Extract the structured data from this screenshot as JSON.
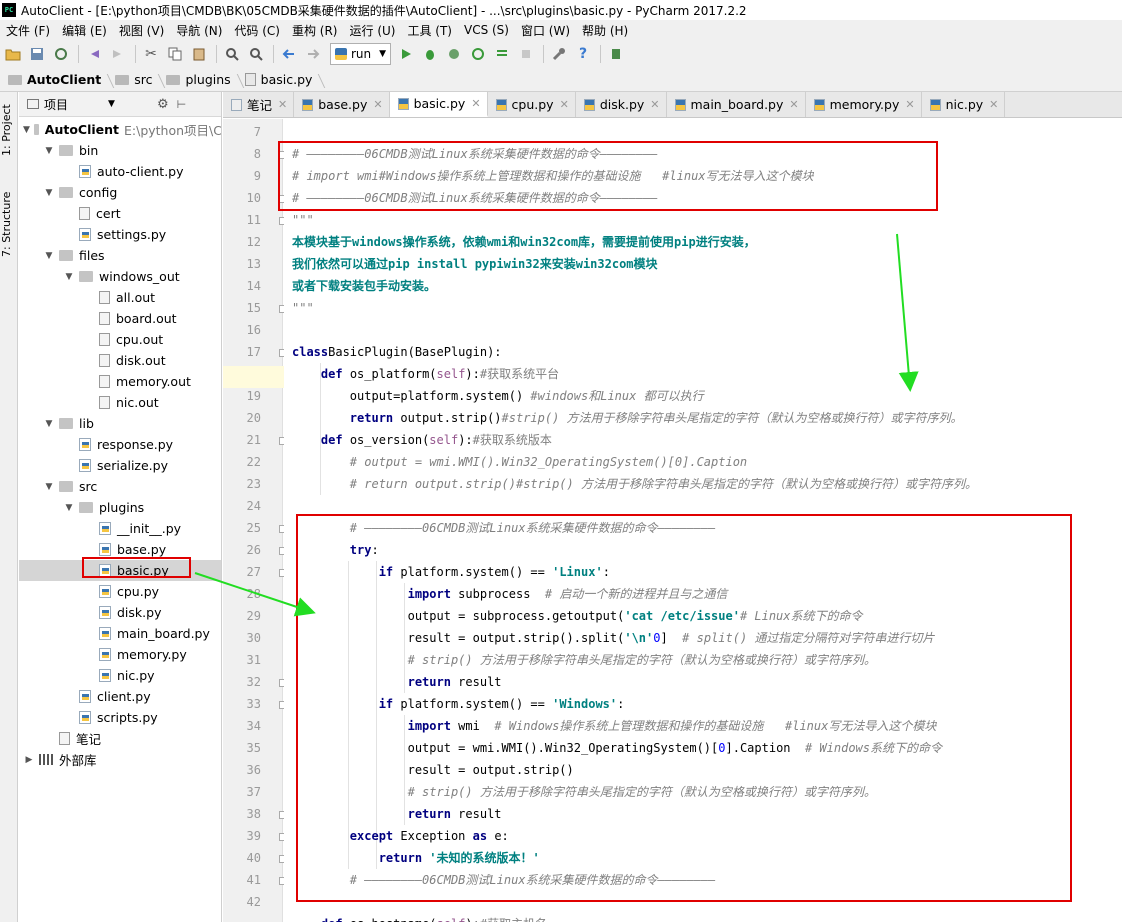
{
  "window": {
    "title": "AutoClient - [E:\\python项目\\CMDB\\BK\\05CMDB采集硬件数据的插件\\AutoClient] - ...\\src\\plugins\\basic.py - PyCharm 2017.2.2",
    "logo_text": "PC"
  },
  "menu": [
    "文件 (F)",
    "编辑 (E)",
    "视图 (V)",
    "导航 (N)",
    "代码 (C)",
    "重构 (R)",
    "运行 (U)",
    "工具 (T)",
    "VCS (S)",
    "窗口 (W)",
    "帮助 (H)"
  ],
  "toolbar": {
    "run_config": "run",
    "icons": [
      "open-icon",
      "save-icon",
      "sync-icon",
      "back-icon",
      "forward-icon",
      "cut-icon",
      "copy-icon",
      "paste-icon",
      "find-icon",
      "replace-icon",
      "nav-back-icon",
      "nav-forward-icon"
    ]
  },
  "breadcrumb": [
    "AutoClient",
    "src",
    "plugins",
    "basic.py"
  ],
  "left_strip": {
    "project_tab": "1: Project",
    "structure_tab": "7: Structure"
  },
  "project_panel": {
    "title": "项目",
    "tree": [
      {
        "label": "AutoClient",
        "hint": "E:\\python项目\\C",
        "type": "folder",
        "depth": 0,
        "expanded": true,
        "bold": true
      },
      {
        "label": "bin",
        "type": "folder",
        "depth": 1,
        "expanded": true
      },
      {
        "label": "auto-client.py",
        "type": "py",
        "depth": 2
      },
      {
        "label": "config",
        "type": "folder",
        "depth": 1,
        "expanded": true
      },
      {
        "label": "cert",
        "type": "file",
        "depth": 2
      },
      {
        "label": "settings.py",
        "type": "py",
        "depth": 2
      },
      {
        "label": "files",
        "type": "folder",
        "depth": 1,
        "expanded": true
      },
      {
        "label": "windows_out",
        "type": "folder",
        "depth": 2,
        "expanded": true
      },
      {
        "label": "all.out",
        "type": "file",
        "depth": 3
      },
      {
        "label": "board.out",
        "type": "file",
        "depth": 3
      },
      {
        "label": "cpu.out",
        "type": "file",
        "depth": 3
      },
      {
        "label": "disk.out",
        "type": "file",
        "depth": 3
      },
      {
        "label": "memory.out",
        "type": "file",
        "depth": 3
      },
      {
        "label": "nic.out",
        "type": "file",
        "depth": 3
      },
      {
        "label": "lib",
        "type": "folder",
        "depth": 1,
        "expanded": true
      },
      {
        "label": "response.py",
        "type": "py",
        "depth": 2
      },
      {
        "label": "serialize.py",
        "type": "py",
        "depth": 2
      },
      {
        "label": "src",
        "type": "folder",
        "depth": 1,
        "expanded": true
      },
      {
        "label": "plugins",
        "type": "folder",
        "depth": 2,
        "expanded": true
      },
      {
        "label": "__init__.py",
        "type": "py",
        "depth": 3
      },
      {
        "label": "base.py",
        "type": "py",
        "depth": 3
      },
      {
        "label": "basic.py",
        "type": "py",
        "depth": 3,
        "selected": true
      },
      {
        "label": "cpu.py",
        "type": "py",
        "depth": 3
      },
      {
        "label": "disk.py",
        "type": "py",
        "depth": 3
      },
      {
        "label": "main_board.py",
        "type": "py",
        "depth": 3
      },
      {
        "label": "memory.py",
        "type": "py",
        "depth": 3
      },
      {
        "label": "nic.py",
        "type": "py",
        "depth": 3
      },
      {
        "label": "client.py",
        "type": "py",
        "depth": 2
      },
      {
        "label": "scripts.py",
        "type": "py",
        "depth": 2
      },
      {
        "label": "笔记",
        "type": "file",
        "depth": 1
      },
      {
        "label": "外部库",
        "type": "lib",
        "depth": 0,
        "expanded": false
      }
    ]
  },
  "editor_tabs": [
    {
      "label": "笔记",
      "note": true
    },
    {
      "label": "base.py"
    },
    {
      "label": "basic.py",
      "active": true
    },
    {
      "label": "cpu.py"
    },
    {
      "label": "disk.py"
    },
    {
      "label": "main_board.py"
    },
    {
      "label": "memory.py"
    },
    {
      "label": "nic.py"
    }
  ],
  "editor": {
    "line_numbers": [
      "7",
      "8",
      "9",
      "10",
      "11",
      "12",
      "13",
      "14",
      "15",
      "16",
      "17",
      "18",
      "19",
      "20",
      "21",
      "22",
      "23",
      "24",
      "25",
      "26",
      "27",
      "28",
      "29",
      "30",
      "31",
      "32",
      "33",
      "34",
      "35",
      "36",
      "37",
      "38",
      "39",
      "40",
      "41",
      "42"
    ],
    "code_lines": [
      [],
      [
        [
          "cm",
          "# ————————06CMDB测试Linux系统采集硬件数据的命令————————"
        ]
      ],
      [
        [
          "cm",
          "# import wmi#Windows操作系统上管理数据和操作的基础设施   #linux写无法导入这个模块"
        ]
      ],
      [
        [
          "cm",
          "# ————————06CMDB测试Linux系统采集硬件数据的命令————————"
        ]
      ],
      [
        [
          "cm",
          "\"\"\""
        ]
      ],
      [
        [
          "docs",
          "本模块基于windows操作系统，依赖wmi和win32com库，需要提前使用pip进行安装，"
        ]
      ],
      [
        [
          "docs",
          "我们依然可以通过pip install pypiwin32来安装win32com模块"
        ]
      ],
      [
        [
          "docs",
          "或者下载安装包手动安装。"
        ]
      ],
      [
        [
          "cm",
          "\"\"\""
        ]
      ],
      [],
      [
        [
          "kw",
          "class"
        ],
        [
          "",
          "BasicPlugin(BasePlugin):"
        ]
      ],
      [
        [
          "",
          "    "
        ],
        [
          "kw",
          "def"
        ],
        [
          "",
          " os_platform("
        ],
        [
          "slf",
          "self"
        ],
        [
          "",
          "):"
        ],
        [
          "cmz",
          "#获取系统平台"
        ]
      ],
      [
        [
          "",
          "        output=platform.system() "
        ],
        [
          "cm",
          "#windows和Linux 都可以执行"
        ]
      ],
      [
        [
          "",
          "        "
        ],
        [
          "kw",
          "return"
        ],
        [
          "",
          " output.strip()"
        ],
        [
          "cm",
          "#strip() 方法用于移除字符串头尾指定的字符（默认为空格或换行符）或字符序列。"
        ]
      ],
      [
        [
          "",
          "    "
        ],
        [
          "kw",
          "def"
        ],
        [
          "",
          " os_version("
        ],
        [
          "slf",
          "self"
        ],
        [
          "",
          "):"
        ],
        [
          "cmz",
          "#获取系统版本"
        ]
      ],
      [
        [
          "",
          "        "
        ],
        [
          "cm",
          "# output = wmi.WMI().Win32_OperatingSystem()[0].Caption"
        ]
      ],
      [
        [
          "",
          "        "
        ],
        [
          "cm",
          "# return output.strip()#strip() 方法用于移除字符串头尾指定的字符（默认为空格或换行符）或字符序列。"
        ]
      ],
      [],
      [
        [
          "",
          "        "
        ],
        [
          "cm",
          "# ————————06CMDB测试Linux系统采集硬件数据的命令————————"
        ]
      ],
      [
        [
          "",
          "        "
        ],
        [
          "kw",
          "try"
        ],
        [
          "",
          ":"
        ]
      ],
      [
        [
          "",
          "            "
        ],
        [
          "kw",
          "if"
        ],
        [
          "",
          " platform.system() == "
        ],
        [
          "str",
          "'Linux'"
        ],
        [
          "",
          ":"
        ]
      ],
      [
        [
          "",
          "                "
        ],
        [
          "kw",
          "import"
        ],
        [
          "",
          " subprocess  "
        ],
        [
          "cm",
          "# 启动一个新的进程并且与之通信"
        ]
      ],
      [
        [
          "",
          "                output = subprocess.getoutput("
        ],
        [
          "str",
          "'cat /etc/issue'"
        ],
        [
          ")  "
        ],
        [
          "cm",
          "# Linux系统下的命令"
        ]
      ],
      [
        [
          "",
          "                result = output.strip().split("
        ],
        [
          "str",
          "'\\n'"
        ],
        [
          ")["
        ],
        [
          "num",
          "0"
        ],
        [
          "",
          "]  "
        ],
        [
          "cm",
          "# split() 通过指定分隔符对字符串进行切片"
        ]
      ],
      [
        [
          "",
          "                "
        ],
        [
          "cm",
          "# strip() 方法用于移除字符串头尾指定的字符（默认为空格或换行符）或字符序列。"
        ]
      ],
      [
        [
          "",
          "                "
        ],
        [
          "kw",
          "return"
        ],
        [
          "",
          " result"
        ]
      ],
      [
        [
          "",
          "            "
        ],
        [
          "kw",
          "if"
        ],
        [
          "",
          " platform.system() == "
        ],
        [
          "str",
          "'Windows'"
        ],
        [
          "",
          ":"
        ]
      ],
      [
        [
          "",
          "                "
        ],
        [
          "kw",
          "import"
        ],
        [
          "",
          " wmi  "
        ],
        [
          "cm",
          "# Windows操作系统上管理数据和操作的基础设施   #linux写无法导入这个模块"
        ]
      ],
      [
        [
          "",
          "                output = wmi.WMI().Win32_OperatingSystem()["
        ],
        [
          "num",
          "0"
        ],
        [
          "",
          "].Caption  "
        ],
        [
          "cm",
          "# Windows系统下的命令"
        ]
      ],
      [
        [
          "",
          "                result = output.strip()"
        ]
      ],
      [
        [
          "",
          "                "
        ],
        [
          "cm",
          "# strip() 方法用于移除字符串头尾指定的字符（默认为空格或换行符）或字符序列。"
        ]
      ],
      [
        [
          "",
          "                "
        ],
        [
          "kw",
          "return"
        ],
        [
          "",
          " result"
        ]
      ],
      [
        [
          "",
          "        "
        ],
        [
          "kw",
          "except"
        ],
        [
          "",
          " Exception "
        ],
        [
          "kw",
          "as"
        ],
        [
          "",
          " e:"
        ]
      ],
      [
        [
          "",
          "            "
        ],
        [
          "kw",
          "return"
        ],
        [
          "",
          " "
        ],
        [
          "str",
          "'未知的系统版本！'"
        ]
      ],
      [
        [
          "",
          "        "
        ],
        [
          "cm",
          "# ————————06CMDB测试Linux系统采集硬件数据的命令————————"
        ]
      ],
      [],
      [
        [
          "",
          "    "
        ],
        [
          "kw",
          "def"
        ],
        [
          "",
          " os_hostname("
        ],
        [
          "slf",
          "self"
        ],
        [
          "",
          "):"
        ],
        [
          "cmz",
          "#获取主机名"
        ]
      ]
    ]
  },
  "annotations": {
    "highlight_color": "#e00000",
    "arrow_color": "#22dd22"
  }
}
